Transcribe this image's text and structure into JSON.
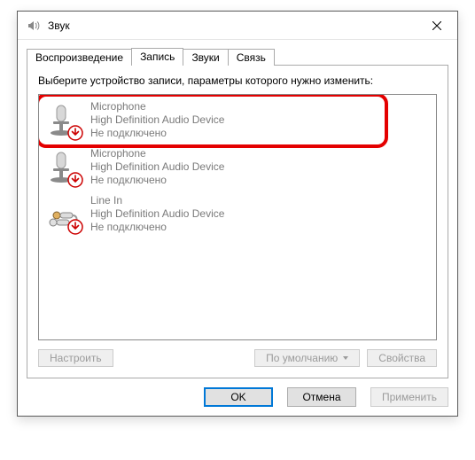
{
  "window": {
    "title": "Звук"
  },
  "tabs": [
    {
      "label": "Воспроизведение"
    },
    {
      "label": "Запись"
    },
    {
      "label": "Звуки"
    },
    {
      "label": "Связь"
    }
  ],
  "active_tab_index": 1,
  "instructions": "Выберите устройство записи, параметры которого нужно изменить:",
  "devices": [
    {
      "name": "Microphone",
      "desc": "High Definition Audio Device",
      "status": "Не подключено",
      "icon": "mic",
      "badge": "down"
    },
    {
      "name": "Microphone",
      "desc": "High Definition Audio Device",
      "status": "Не подключено",
      "icon": "mic",
      "badge": "down"
    },
    {
      "name": "Line In",
      "desc": "High Definition Audio Device",
      "status": "Не подключено",
      "icon": "linein",
      "badge": "down"
    }
  ],
  "buttons": {
    "configure": "Настроить",
    "set_default": "По умолчанию",
    "properties": "Свойства",
    "ok": "OK",
    "cancel": "Отмена",
    "apply": "Применить"
  }
}
